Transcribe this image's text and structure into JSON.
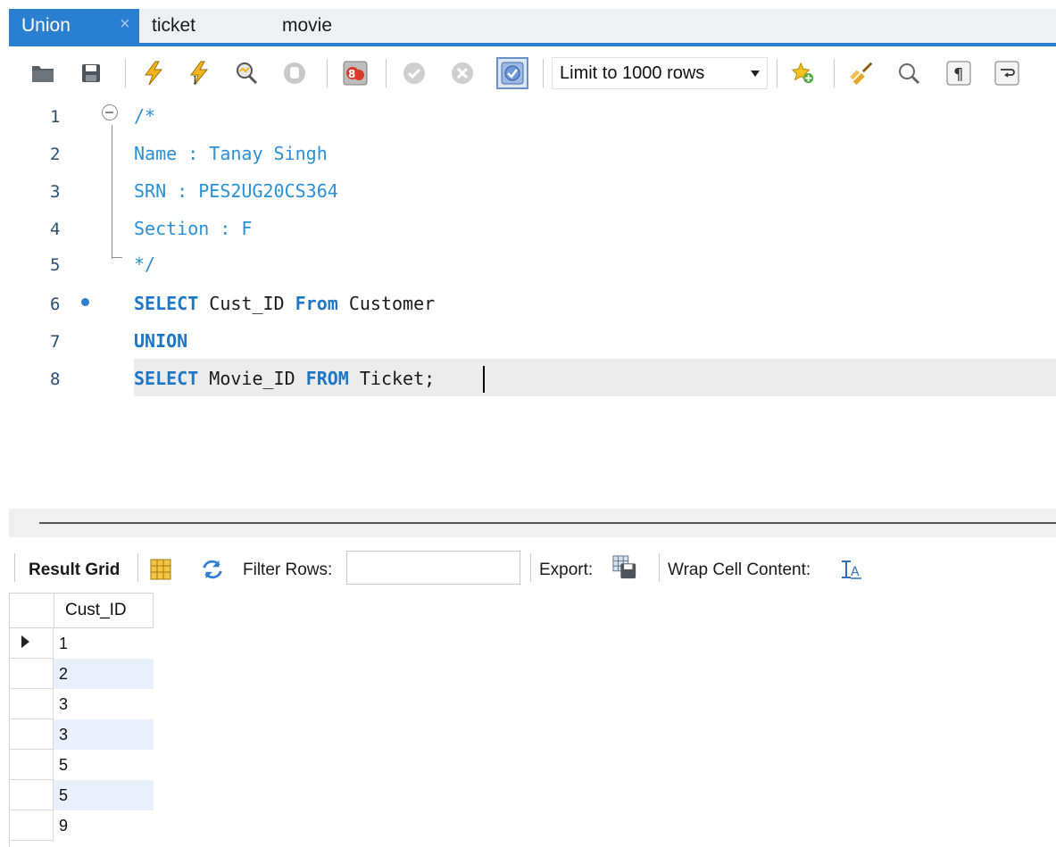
{
  "tabs": [
    {
      "label": "Union",
      "active": true
    },
    {
      "label": "ticket",
      "active": false
    },
    {
      "label": "movie",
      "active": false
    }
  ],
  "tab_close_glyph": "×",
  "toolbar": {
    "icons": [
      "open-folder-icon",
      "save-icon",
      "execute-icon",
      "execute-current-icon",
      "explain-icon",
      "stop-icon",
      "toggle-error-icon",
      "commit-icon",
      "rollback-icon",
      "autocommit-icon"
    ],
    "limit_select": "Limit to 1000 rows",
    "right_icons": [
      "add-snippet-icon",
      "beautify-icon",
      "find-icon",
      "invisible-chars-icon",
      "word-wrap-icon"
    ]
  },
  "editor": {
    "lines": [
      {
        "num": "1",
        "parts": [
          {
            "t": "/*",
            "k": "comment"
          }
        ]
      },
      {
        "num": "2",
        "parts": [
          {
            "t": "Name : Tanay Singh",
            "k": "comment"
          }
        ]
      },
      {
        "num": "3",
        "parts": [
          {
            "t": "SRN : PES2UG20CS364",
            "k": "comment"
          }
        ]
      },
      {
        "num": "4",
        "parts": [
          {
            "t": "Section : F",
            "k": "comment"
          }
        ]
      },
      {
        "num": "5",
        "parts": [
          {
            "t": "*/",
            "k": "comment"
          }
        ]
      },
      {
        "num": "6",
        "parts": [
          {
            "t": "SELECT",
            "k": "kw"
          },
          {
            "t": " Cust_ID ",
            "k": "id"
          },
          {
            "t": "From",
            "k": "kw"
          },
          {
            "t": " Customer",
            "k": "id"
          }
        ]
      },
      {
        "num": "7",
        "parts": [
          {
            "t": "UNION",
            "k": "kw"
          }
        ]
      },
      {
        "num": "8",
        "parts": [
          {
            "t": "SELECT",
            "k": "kw"
          },
          {
            "t": " Movie_ID ",
            "k": "id"
          },
          {
            "t": "FROM",
            "k": "kw"
          },
          {
            "t": " Ticket;",
            "k": "id"
          }
        ]
      }
    ]
  },
  "result_toolbar": {
    "result_grid": "Result Grid",
    "filter_rows": "Filter Rows:",
    "filter_value": "",
    "export": "Export:",
    "wrap": "Wrap Cell Content:"
  },
  "grid": {
    "column": "Cust_ID",
    "rows": [
      "1",
      "2",
      "3",
      "3",
      "5",
      "5",
      "9"
    ]
  },
  "colors": {
    "accent": "#2b7fd1",
    "comment": "#2b8fd6",
    "keyword": "#1f76c5"
  }
}
